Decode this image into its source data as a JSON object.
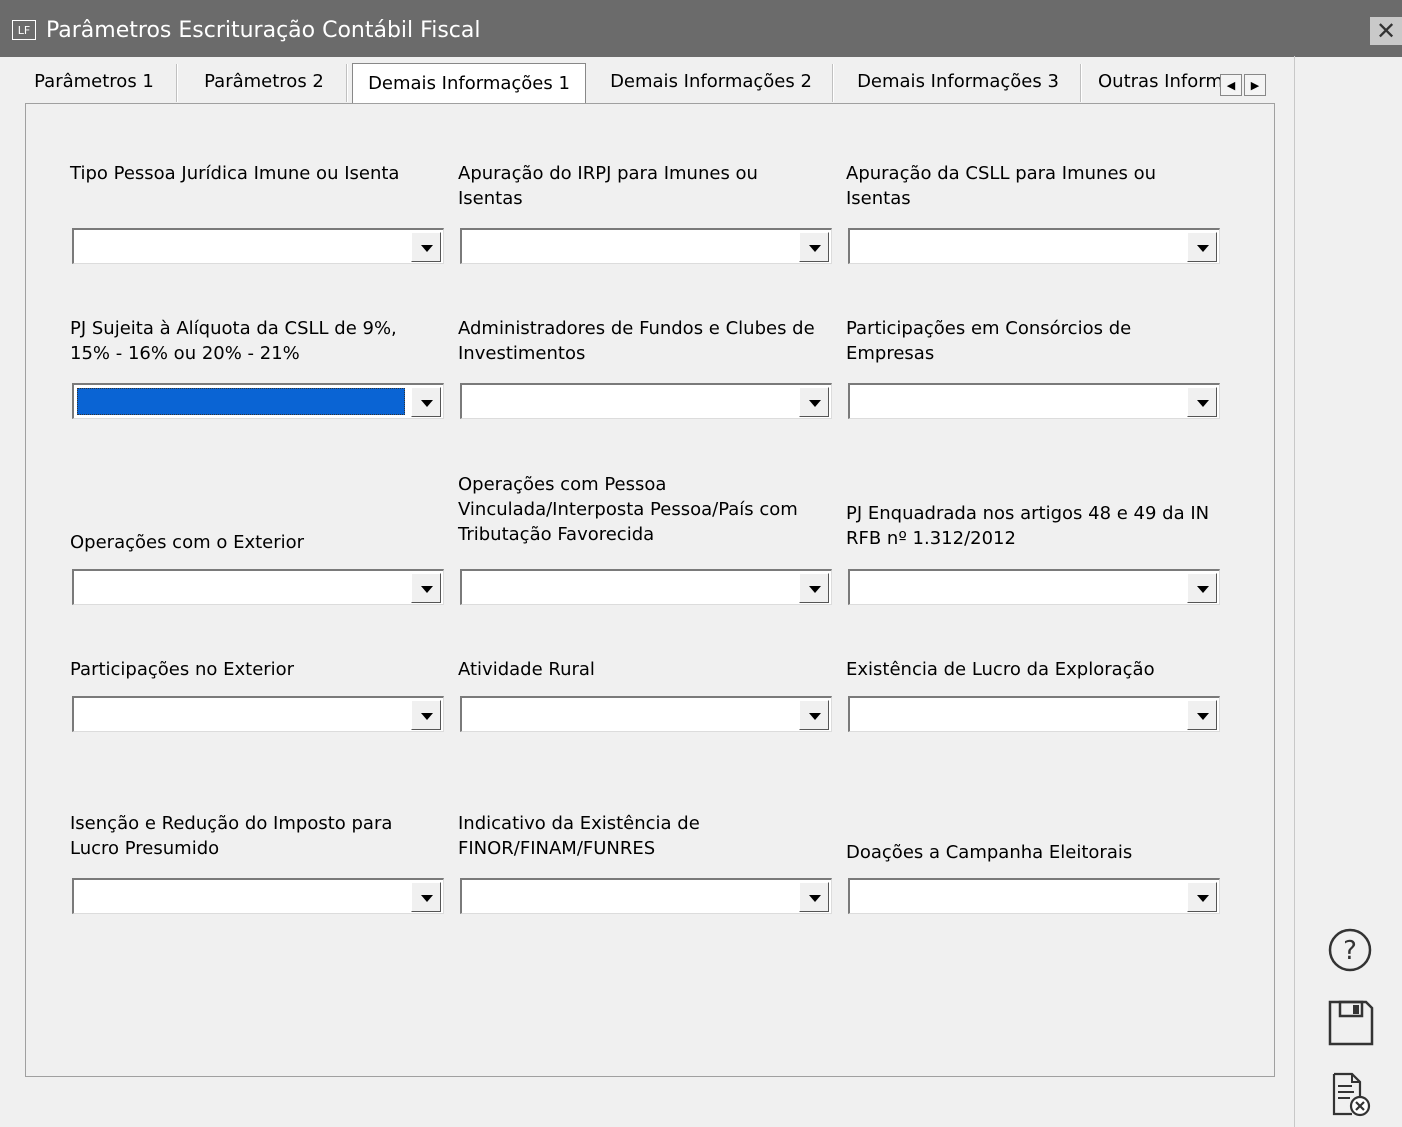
{
  "window": {
    "icon_text": "LF",
    "title": "Parâmetros Escrituração Contábil Fiscal",
    "close_glyph": "✕"
  },
  "tabs": [
    {
      "label": "Parâmetros 1",
      "active": false
    },
    {
      "label": "Parâmetros 2",
      "active": false
    },
    {
      "label": "Demais Informações 1",
      "active": true
    },
    {
      "label": "Demais Informações 2",
      "active": false
    },
    {
      "label": "Demais Informações 3",
      "active": false
    },
    {
      "label": "Outras Informações",
      "active": false
    }
  ],
  "tab_scroll": {
    "left": "◀",
    "right": "▶"
  },
  "fields": [
    {
      "label_lines": [
        "Tipo Pessoa Jurídica Imune ou Isenta"
      ],
      "value": ""
    },
    {
      "label_lines": [
        "Apuração do IRPJ para Imunes ou",
        "Isentas"
      ],
      "value": ""
    },
    {
      "label_lines": [
        "Apuração da CSLL para Imunes ou",
        "Isentas"
      ],
      "value": ""
    },
    {
      "label_lines": [
        "PJ Sujeita à Alíquota da CSLL de 9%,",
        "15% - 16% ou 20% - 21%"
      ],
      "value": "",
      "selected": true
    },
    {
      "label_lines": [
        "Administradores de Fundos e Clubes de",
        "Investimentos"
      ],
      "value": ""
    },
    {
      "label_lines": [
        "Participações em Consórcios de",
        "Empresas"
      ],
      "value": ""
    },
    {
      "label_lines": [
        "Operações com o Exterior"
      ],
      "value": ""
    },
    {
      "label_lines": [
        "Operações com Pessoa",
        "Vinculada/Interposta Pessoa/País com",
        "Tributação Favorecida"
      ],
      "value": ""
    },
    {
      "label_lines": [
        "PJ Enquadrada nos artigos 48 e 49 da IN",
        "RFB nº 1.312/2012"
      ],
      "value": ""
    },
    {
      "label_lines": [
        "Participações no Exterior"
      ],
      "value": ""
    },
    {
      "label_lines": [
        "Atividade Rural"
      ],
      "value": ""
    },
    {
      "label_lines": [
        "Existência de Lucro da Exploração"
      ],
      "value": ""
    },
    {
      "label_lines": [
        "Isenção e Redução do Imposto para",
        "Lucro Presumido"
      ],
      "value": ""
    },
    {
      "label_lines": [
        "Indicativo da Existência de",
        "FINOR/FINAM/FUNRES"
      ],
      "value": ""
    },
    {
      "label_lines": [
        "Doações a Campanha Eleitorais"
      ],
      "value": ""
    }
  ],
  "side_buttons": [
    {
      "icon": "help-icon",
      "glyph": "?"
    },
    {
      "icon": "save-icon"
    },
    {
      "icon": "cancel-document-icon"
    }
  ]
}
